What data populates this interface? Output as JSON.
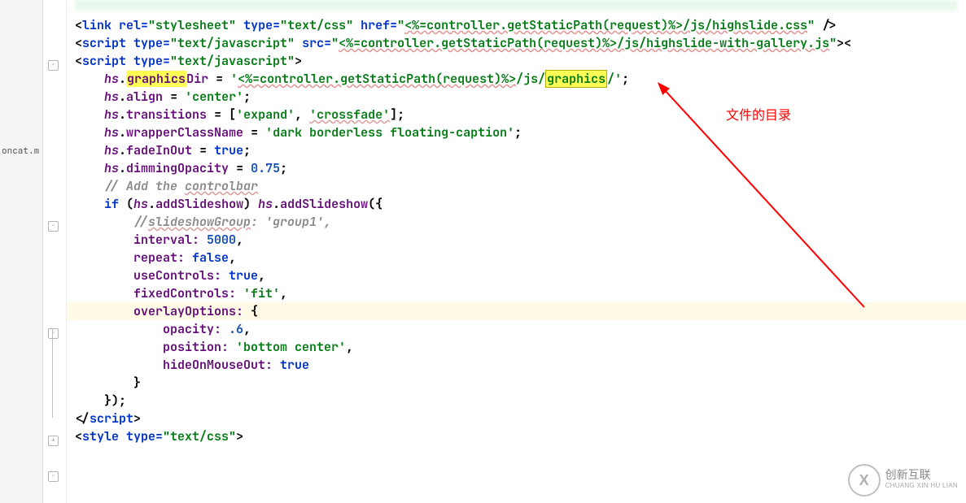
{
  "sidebar": {
    "filename": "oncat.m"
  },
  "annotation": {
    "label": "文件的目录"
  },
  "logo": {
    "cn": "创新互联",
    "en": "CHUANG XIN HU LIAN",
    "icon": "X"
  },
  "code": {
    "l1": {
      "pre": "<",
      "tag": "link ",
      "a1": "rel=",
      "v1": "\"stylesheet\" ",
      "a2": "type=",
      "v2": "\"text/css\" ",
      "a3": "href=",
      "v3a": "\"",
      "v3b": "<%=controller.getStaticPath(request)%>",
      "v3c": "/js/highslide.css",
      "v3d": "\" ",
      "end": "/>"
    },
    "l2": {
      "pre": "<",
      "tag": "script ",
      "a1": "type=",
      "v1": "\"text/javascript\" ",
      "a2": "src=",
      "v2a": "\"",
      "v2b": "<%=controller.getStaticPath(request)%>",
      "v2c": "/js/highslide-with-gallery.js",
      "v2d": "\"",
      "end": "><"
    },
    "l3": {
      "pre": "<",
      "tag": "script ",
      "a1": "type=",
      "v1": "\"text/javascript\"",
      "end": ">"
    },
    "l4": {
      "obj": "hs",
      "dot": ".",
      "hl": "graphics",
      "rest": "Dir",
      "eq": " = ",
      "s1": "'",
      "s2": "<%=controller.getStaticPath(request)%>",
      "s3": "/js/",
      "s4": "graphics",
      "s5": "/'",
      "semi": ";"
    },
    "l5": {
      "obj": "hs",
      "dot": ".",
      "prop": "align",
      "eq": " = ",
      "val": "'center'",
      "semi": ";"
    },
    "l6": {
      "obj": "hs",
      "dot": ".",
      "prop": "transitions",
      "eq": " = [",
      "v1": "'expand'",
      "comma": ", ",
      "v2": "'crossfade'",
      "end": "];"
    },
    "l7": {
      "obj": "hs",
      "dot": ".",
      "prop": "wrapperClassName",
      "eq": " = ",
      "val": "'dark borderless floating-caption'",
      "semi": ";"
    },
    "l8": {
      "obj": "hs",
      "dot": ".",
      "prop": "fadeInOut",
      "eq": " = ",
      "val": "true",
      "semi": ";"
    },
    "l9": {
      "obj": "hs",
      "dot": ".",
      "prop": "dimmingOpacity",
      "eq": " = ",
      "val": "0.75",
      "semi": ";"
    },
    "l10": "",
    "l11": {
      "txt": "// Add the ",
      "u": "controlbar"
    },
    "l12": {
      "kw": "if ",
      "open": "(",
      "obj": "hs",
      "dot": ".",
      "prop": "addSlideshow",
      "close": ") ",
      "obj2": "hs",
      "dot2": ".",
      "prop2": "addSlideshow",
      "rest": "({"
    },
    "l13": {
      "txt": "//",
      "u": "slideshowGroup",
      "rest": ": 'group1',"
    },
    "l14": {
      "prop": "interval:",
      "sp": " ",
      "val": "5000",
      "end": ","
    },
    "l15": {
      "prop": "repeat:",
      "sp": " ",
      "val": "false",
      "end": ","
    },
    "l16": {
      "prop": "useControls:",
      "sp": " ",
      "val": "true",
      "end": ","
    },
    "l17": {
      "prop": "fixedControls:",
      "sp": " ",
      "val": "'fit'",
      "end": ","
    },
    "l18": {
      "prop": "overlayOptions:",
      "sp": " ",
      "rest": "{"
    },
    "l19": {
      "prop": "opacity:",
      "sp": " ",
      "val": ".6",
      "end": ","
    },
    "l20": {
      "prop": "position:",
      "sp": " ",
      "val": "'bottom center'",
      "end": ","
    },
    "l21": {
      "prop": "hideOnMouseOut:",
      "sp": " ",
      "val": "true"
    },
    "l22": "        }",
    "l23": "    });",
    "l24": {
      "pre": "</",
      "tag": "script",
      "end": ">"
    },
    "l25": "",
    "l26": {
      "pre": "<",
      "tag": "style ",
      "a1": "type=",
      "v1": "\"text/css\"",
      "end": ">"
    }
  }
}
